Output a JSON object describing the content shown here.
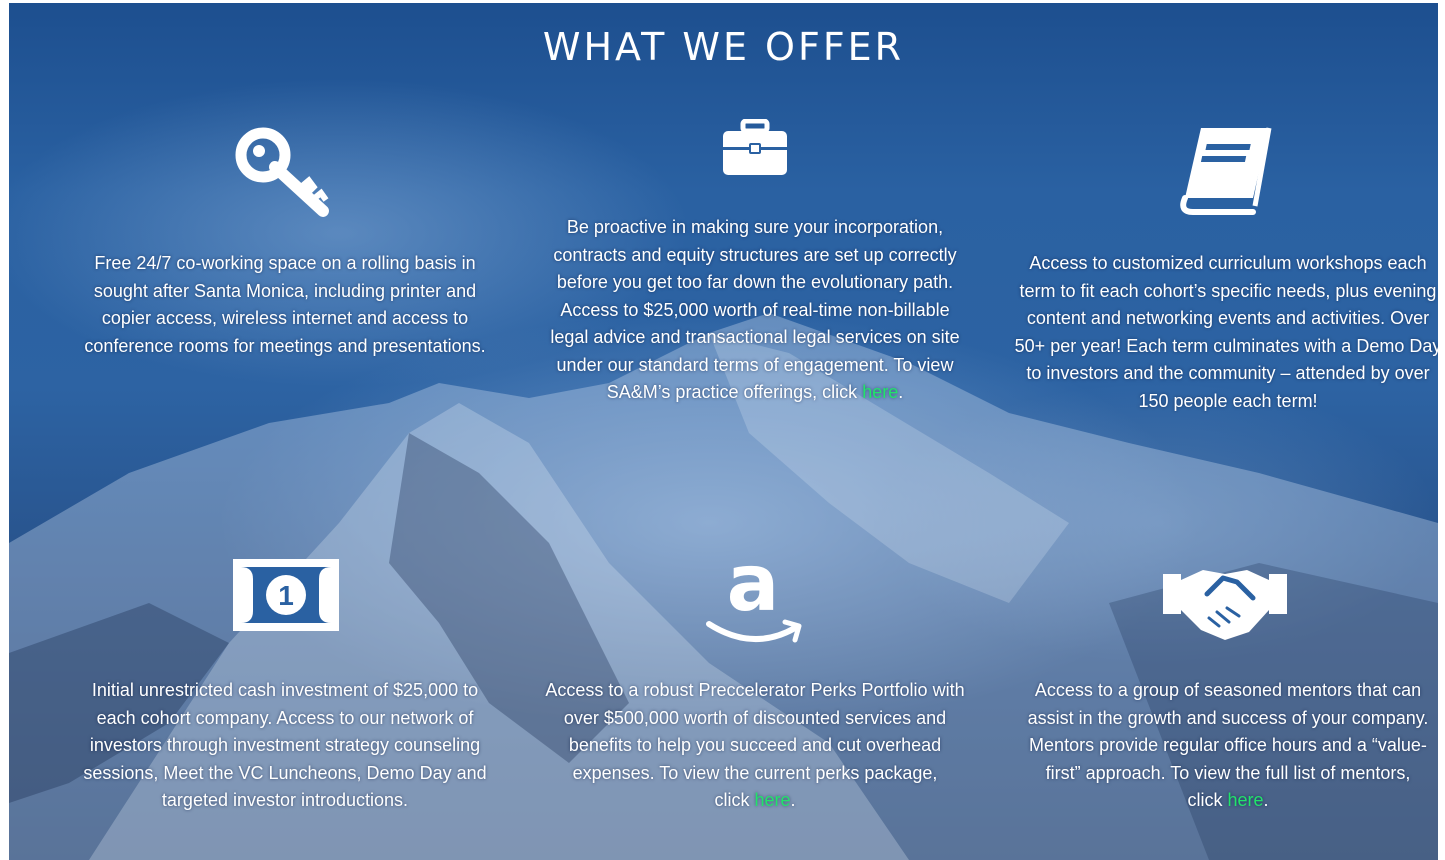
{
  "section": {
    "title": "WHAT WE OFFER",
    "link_color": "#22e36a",
    "background_color": "#2a61a2"
  },
  "offers": [
    {
      "icon": "key-icon",
      "text": "Free 24/7 co-working space on a rolling basis in sought after Santa Monica, including printer and copier access, wireless internet and access to conference rooms for meetings and presentations."
    },
    {
      "icon": "briefcase-icon",
      "text": "Be proactive in making sure your incorporation, contracts and equity structures are set up correctly before you get too far down the evolutionary path. Access to $25,000 worth of real-time non-billable legal advice and transactional legal services on site under our standard terms of engagement.  To view SA&M’s practice offerings, click ",
      "link": "here",
      "after": "."
    },
    {
      "icon": "book-icon",
      "text": "Access to customized curriculum workshops each term to fit each cohort’s specific needs, plus evening content and networking events and activities. Over 50+ per year!  Each term culminates with a Demo Day to investors and the community – attended by over 150 people each term!"
    },
    {
      "icon": "dollar-bill-icon",
      "text": "Initial unrestricted cash investment of $25,000 to each cohort company.  Access to our network of investors through investment strategy counseling sessions, Meet the VC Luncheons, Demo Day and targeted investor introductions."
    },
    {
      "icon": "amazon-icon",
      "text": "Access to a robust Preccelerator Perks Portfolio with over $500,000 worth of discounted services and benefits to help you succeed and cut overhead expenses.  To view the current perks package,",
      "text2": "click ",
      "link": "here",
      "after": "."
    },
    {
      "icon": "handshake-icon",
      "text": "Access to a group of seasoned mentors that can assist in the growth and success of your company. Mentors provide regular office hours and a “value-first” approach.  To view the full list of mentors,",
      "text2": "click ",
      "link": "here",
      "after": "."
    }
  ]
}
